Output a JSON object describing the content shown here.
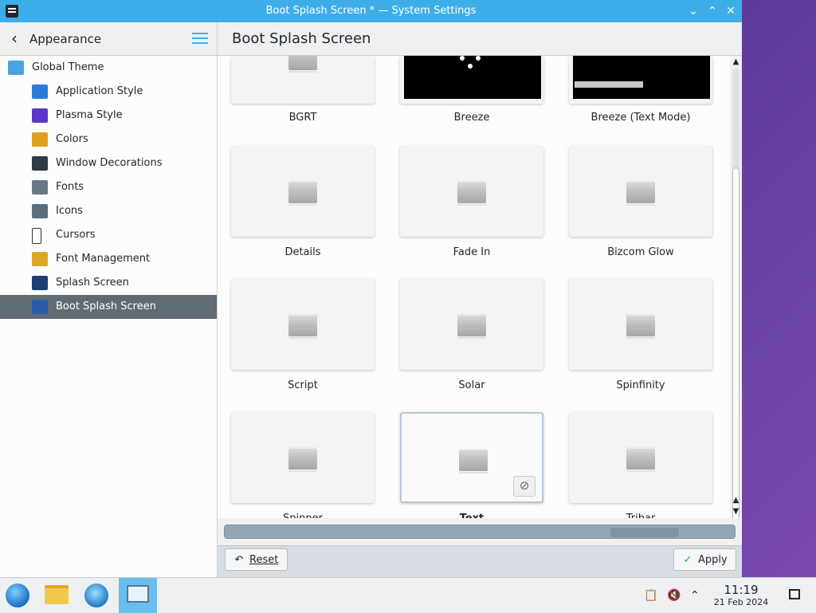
{
  "window": {
    "title": "Boot Splash Screen * — System Settings",
    "controls": {
      "minimize": "⌄",
      "maximize": "⌃",
      "close": "✕"
    }
  },
  "sidebar": {
    "header": "Appearance",
    "items": [
      {
        "label": "Global Theme",
        "icon": "globe-theme-icon",
        "color": "#4aa3df"
      },
      {
        "label": "Application Style",
        "icon": "application-style-icon",
        "color": "#2a7bd6"
      },
      {
        "label": "Plasma Style",
        "icon": "plasma-style-icon",
        "color": "#5c35c9"
      },
      {
        "label": "Colors",
        "icon": "colors-icon",
        "color": "#e0a020"
      },
      {
        "label": "Window Decorations",
        "icon": "window-decorations-icon",
        "color": "#2e3a44"
      },
      {
        "label": "Fonts",
        "icon": "fonts-icon",
        "color": "#6a7784"
      },
      {
        "label": "Icons",
        "icon": "icons-icon",
        "color": "#5a6f80"
      },
      {
        "label": "Cursors",
        "icon": "cursors-icon",
        "color": "#ffffff"
      },
      {
        "label": "Font Management",
        "icon": "font-management-icon",
        "color": "#d9a72a"
      },
      {
        "label": "Splash Screen",
        "icon": "splash-screen-icon",
        "color": "#1f3f73"
      },
      {
        "label": "Boot Splash Screen",
        "icon": "boot-splash-screen-icon",
        "color": "#2a5da8"
      }
    ],
    "selected_index": 10
  },
  "main": {
    "title": "Boot Splash Screen",
    "themes": [
      {
        "name": "BGRT",
        "preview": "placeholder"
      },
      {
        "name": "Breeze",
        "preview": "black-dots"
      },
      {
        "name": "Breeze (Text Mode)",
        "preview": "black-bar"
      },
      {
        "name": "Details",
        "preview": "placeholder"
      },
      {
        "name": "Fade In",
        "preview": "placeholder"
      },
      {
        "name": "Bizcom Glow",
        "preview": "placeholder"
      },
      {
        "name": "Script",
        "preview": "placeholder"
      },
      {
        "name": "Solar",
        "preview": "placeholder"
      },
      {
        "name": "Spinfinity",
        "preview": "placeholder"
      },
      {
        "name": "Spinner",
        "preview": "placeholder"
      },
      {
        "name": "Text",
        "preview": "placeholder",
        "selected": true
      },
      {
        "name": "Tribar",
        "preview": "placeholder"
      }
    ]
  },
  "footer": {
    "reset_label": "Reset",
    "apply_label": "Apply"
  },
  "taskbar": {
    "time": "11:19",
    "date": "21 Feb 2024",
    "apps": [
      "start-menu-icon",
      "file-manager-icon",
      "web-browser-icon",
      "system-settings-icon"
    ]
  },
  "colors": {
    "accent": "#3daee9",
    "selection": "#606b74"
  }
}
